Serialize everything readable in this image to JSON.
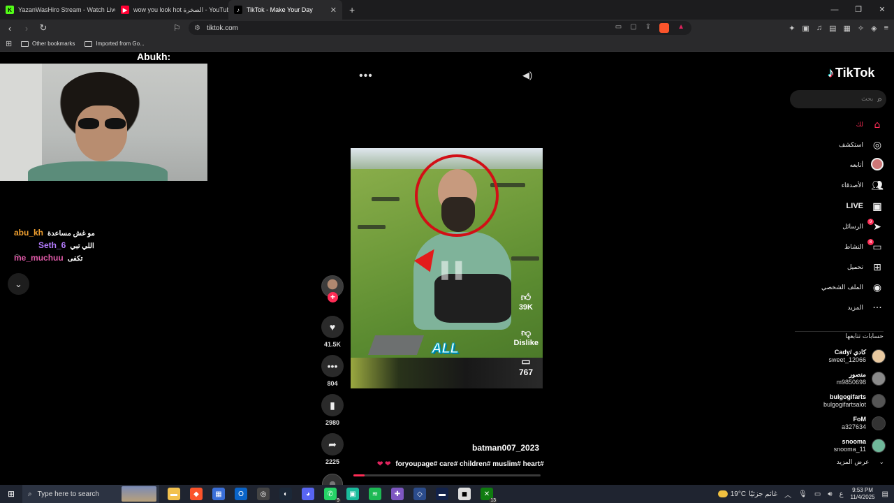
{
  "browser": {
    "tabs": [
      {
        "title": "YazanWasHiro Stream - Watch Live o",
        "icon": "kick-icon",
        "color": "#53fc18"
      },
      {
        "title": "wow you look hot الصخرة - YouTube",
        "icon": "youtube-icon",
        "color": "#ff0033"
      },
      {
        "title": "TikTok - Make Your Day",
        "icon": "tiktok-icon",
        "color": "#000000"
      }
    ],
    "url": "tiktok.com",
    "bookmarks": [
      "Other bookmarks",
      "Imported from Go..."
    ]
  },
  "stream": {
    "streamer_label": "Abukh:",
    "chat": [
      {
        "user": "abu_kh",
        "msg": "مو غش مساعدة",
        "color": "#f0a030"
      },
      {
        "user": "Seth_6",
        "msg": "اللي تبي",
        "color": "#b57cff"
      },
      {
        "user": "me_muchuu",
        "msg": "تكفى",
        "color": "#e05aa8"
      }
    ]
  },
  "video": {
    "caption_word": "ALL",
    "inner_like": "39K",
    "inner_dislike": "Dislike",
    "inner_comments": "767",
    "author": "batman007_2023",
    "tags": "foryoupage# care# children# muslim# heart#",
    "hearts": "❤ ❤",
    "progress_fraction": 0.06
  },
  "actions": {
    "likes": "41.5K",
    "comments": "804",
    "saves": "2980",
    "shares": "2225"
  },
  "tiktok": {
    "logo": "TikTok",
    "search_placeholder": "بحث",
    "nav": [
      {
        "label": "لك",
        "icon": "home-icon",
        "active": true
      },
      {
        "label": "استكشف",
        "icon": "compass-icon"
      },
      {
        "label": "أتابعه",
        "icon": "avatar-icon"
      },
      {
        "label": "الأصدقاء",
        "icon": "friends-icon"
      },
      {
        "label": "LIVE",
        "icon": "live-icon"
      },
      {
        "label": "الرسائل",
        "icon": "messages-icon",
        "badge": "9"
      },
      {
        "label": "النشاط",
        "icon": "activity-icon",
        "badge": "8"
      },
      {
        "label": "تحميل",
        "icon": "upload-icon"
      },
      {
        "label": "الملف الشخصي",
        "icon": "profile-icon"
      },
      {
        "label": "المزيد",
        "icon": "more-icon"
      }
    ],
    "following_title": "حسابات تتابعها",
    "following": [
      {
        "name": "Cady/ كادي",
        "handle": "sweet_12066"
      },
      {
        "name": "منصور",
        "handle": "m9850698"
      },
      {
        "name": "bulgogifarts",
        "handle": "bulgogifartsalot"
      },
      {
        "name": "FoM",
        "handle": "a327634"
      },
      {
        "name": "snooma",
        "handle": "snooma_11"
      }
    ],
    "see_more": "عرض المزيد"
  },
  "taskbar": {
    "search_placeholder": "Type here to search",
    "weather_temp": "19°C",
    "weather_text": "غائم جزئيًا",
    "lang": "ع",
    "time": "9:53 PM",
    "date": "11/4/2025",
    "whatsapp_count": "9",
    "xbox_count": "13"
  }
}
